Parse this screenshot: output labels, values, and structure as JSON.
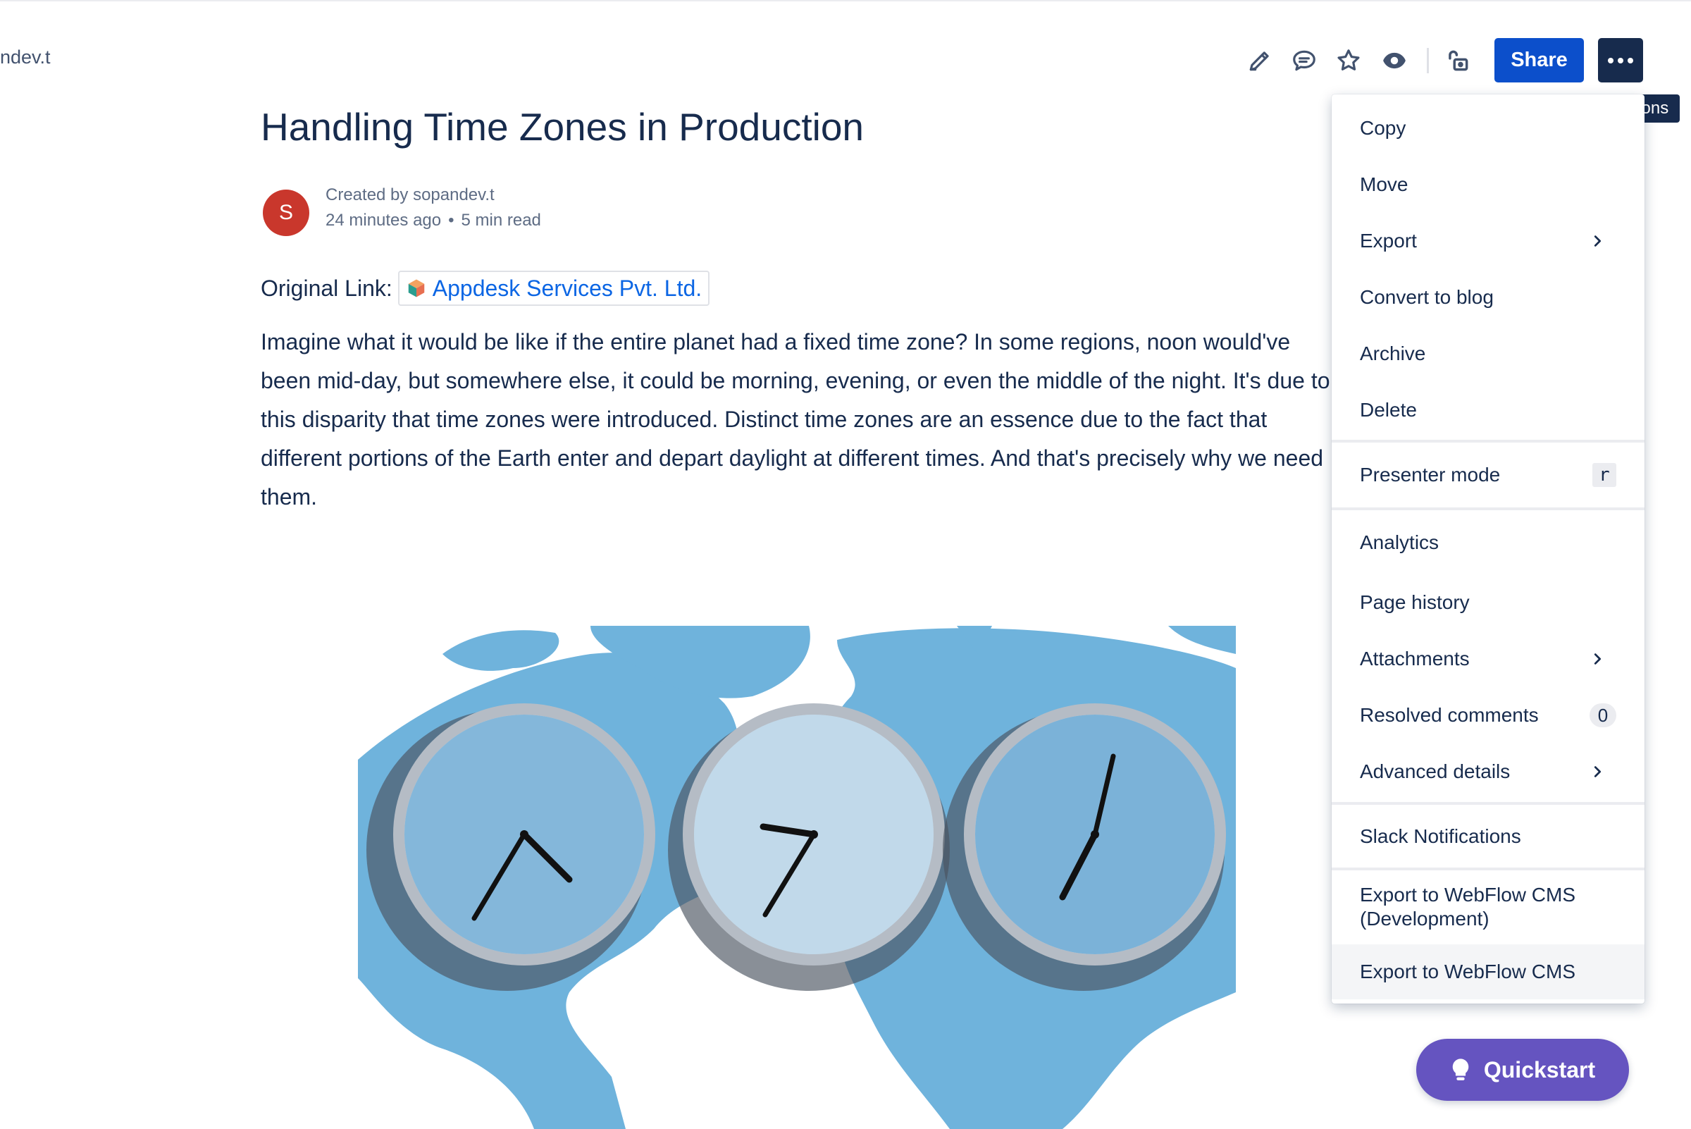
{
  "breadcrumb": "ndev.t",
  "toolbar": {
    "icons": [
      "edit-icon",
      "comment-icon",
      "star-icon",
      "watch-icon",
      "restrictions-icon"
    ],
    "share_label": "Share",
    "more_tooltip": "More actions"
  },
  "page": {
    "title": "Handling Time Zones in Production",
    "avatar_initial": "S",
    "created_by": "Created by sopandev.t",
    "time_ago": "24 minutes ago",
    "read_time": "5 min read",
    "original_link_label": "Original Link:",
    "original_link_text": "Appdesk Services Pvt. Ltd.",
    "paragraph": "Imagine what it would be like if the entire planet had a fixed time zone? In some regions, noon would've been mid-day, but somewhere else, it could be morning, evening, or even the middle of the night. It's due to this disparity that time zones were introduced. Distinct time zones are an essence due to the fact that different portions of the Earth enter and depart daylight at different times. And that's precisely why we need them."
  },
  "menu": {
    "copy": "Copy",
    "move": "Move",
    "export": "Export",
    "convert": "Convert to blog",
    "archive": "Archive",
    "delete": "Delete",
    "presenter": "Presenter mode",
    "presenter_key": "r",
    "analytics": "Analytics",
    "history": "Page history",
    "attachments": "Attachments",
    "resolved": "Resolved comments",
    "resolved_count": "0",
    "advanced": "Advanced details",
    "slack": "Slack Notifications",
    "webflow_dev_1": "Export to WebFlow CMS",
    "webflow_dev_2": "(Development)",
    "webflow": "Export to WebFlow CMS"
  },
  "quickstart": "Quickstart",
  "colors": {
    "share": "#0c4fcb",
    "more": "#172b4d",
    "avatar": "#c9372c",
    "link": "#0c66e4",
    "quickstart": "#6554c0"
  }
}
